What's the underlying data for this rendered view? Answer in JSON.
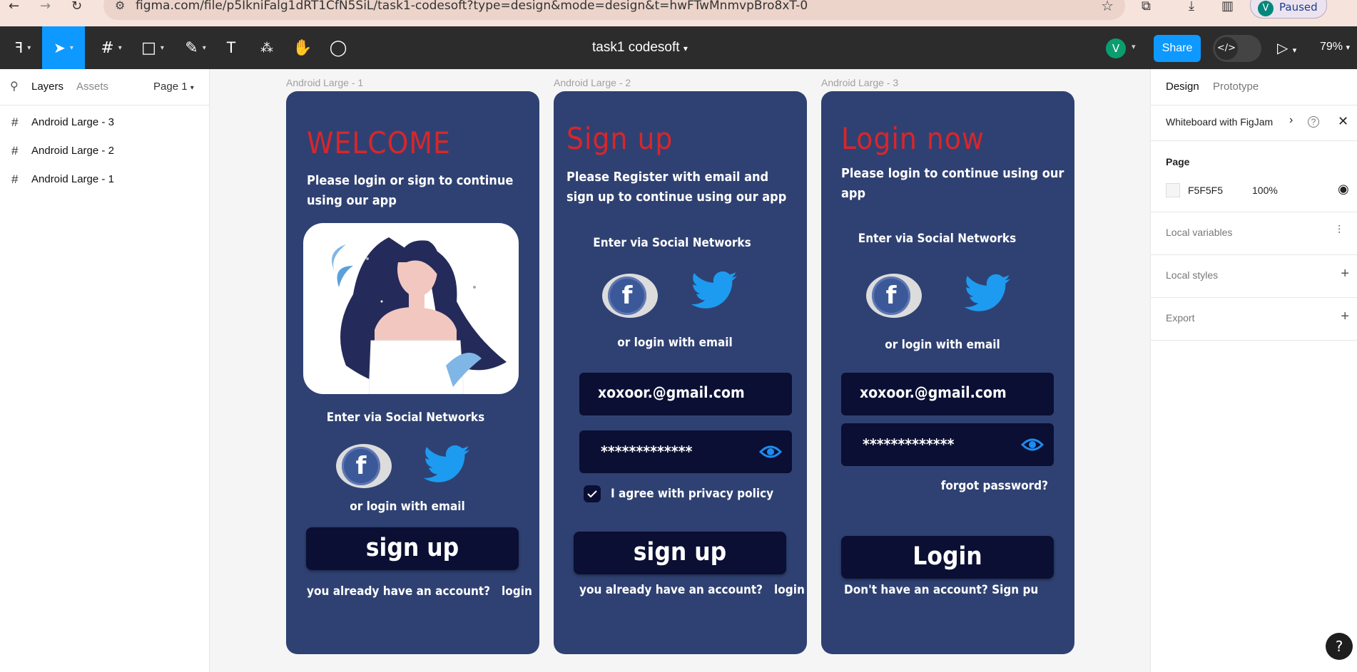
{
  "browser": {
    "url": "figma.com/file/p5IkniFalg1dRT1CfN5SiL/task1-codesoft?type=design&mode=design&t=hwFTwMnmvpBro8xT-0",
    "profile_initial": "V",
    "profile_status": "Paused"
  },
  "toolbar": {
    "file_title": "task1 codesoft",
    "avatar_initial": "V",
    "share_label": "Share",
    "zoom": "79%",
    "accent": "#0d99ff"
  },
  "left_panel": {
    "tabs": [
      "Layers",
      "Assets"
    ],
    "page_selector": "Page 1",
    "layers": [
      {
        "label": "Android Large - 3"
      },
      {
        "label": "Android Large - 2"
      },
      {
        "label": "Android Large - 1"
      }
    ]
  },
  "right_panel": {
    "tabs": [
      "Design",
      "Prototype"
    ],
    "whiteboard_label": "Whiteboard with FigJam",
    "page_heading": "Page",
    "page_color": "F5F5F5",
    "page_opacity": "100%",
    "local_variables": "Local variables",
    "local_styles": "Local styles",
    "export": "Export"
  },
  "canvas": {
    "frames": [
      {
        "label": "Android Large - 1",
        "title": "WELCOME",
        "subtitle": "Please login or sign to continue using our app",
        "social_heading": "Enter  via Social Networks",
        "email_divider": "or login with email",
        "button": "sign up",
        "footer_question": "you already have an account?",
        "footer_link": "login"
      },
      {
        "label": "Android Large - 2",
        "title": "Sign up",
        "subtitle": "Please Register with email and sign up to continue using our app",
        "social_heading": "Enter  via Social Networks",
        "email_divider": "or login with email",
        "email_value": "xoxoor.@gmail.com",
        "password_value": "*************",
        "agree_label": "I agree with privacy policy",
        "button": "sign up",
        "footer_question": "you already have an account?",
        "footer_link": "login"
      },
      {
        "label": "Android Large - 3",
        "title": "Login now",
        "subtitle": "Please login to continue using our app",
        "social_heading": "Enter  via Social Networks",
        "email_divider": "or login with email",
        "email_value": "xoxoor.@gmail.com",
        "password_value": "*************",
        "forgot": "forgot password?",
        "button": "Login",
        "footer": "Don't have an account? Sign pu"
      }
    ],
    "frame_color": "#2f4172",
    "title_color": "#d8262b",
    "field_color": "#0a0f33"
  },
  "help": "?"
}
